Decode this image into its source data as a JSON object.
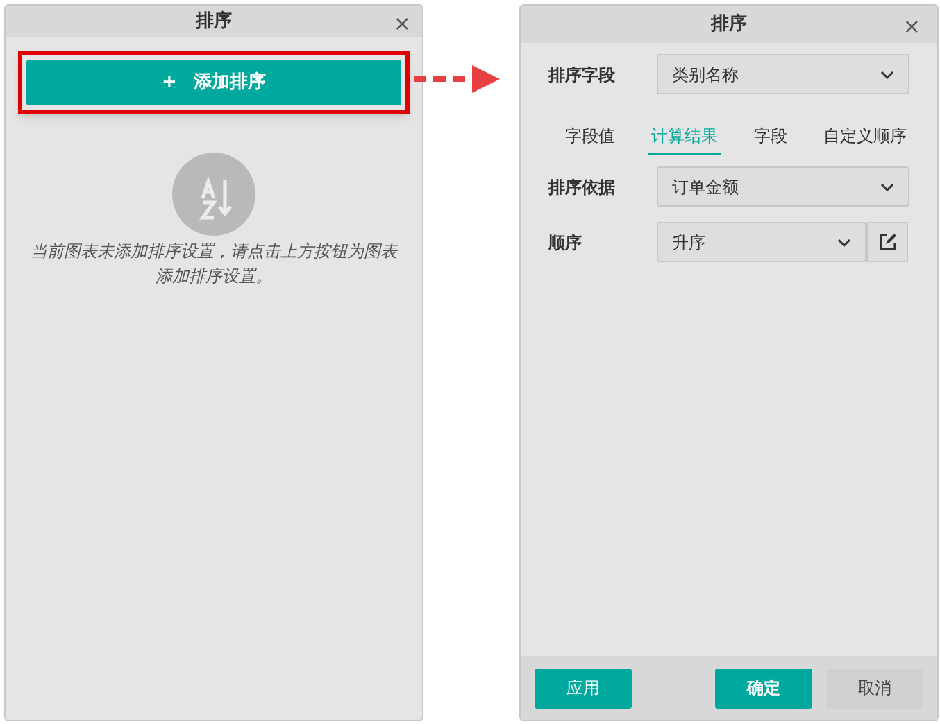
{
  "left_panel": {
    "title": "排序",
    "close": "×",
    "add_button": {
      "icon": "+",
      "label": "添加排序",
      "highlighted": true
    },
    "empty_message": "当前图表未添加排序设置，请点击上方按钮为图表添加排序设置。"
  },
  "right_panel": {
    "title": "排序",
    "close": "×",
    "sort_field": {
      "label": "排序字段",
      "value": "类别名称"
    },
    "tabs": [
      {
        "label": "字段值",
        "selected": false
      },
      {
        "label": "计算结果",
        "selected": true
      },
      {
        "label": "字段",
        "selected": false
      },
      {
        "label": "自定义顺序",
        "selected": false
      }
    ],
    "sort_basis": {
      "label": "排序依据",
      "value": "订单金额"
    },
    "order": {
      "label": "顺序",
      "value": "升序"
    },
    "buttons": {
      "apply": "应用",
      "ok": "确定",
      "cancel": "取消"
    }
  }
}
